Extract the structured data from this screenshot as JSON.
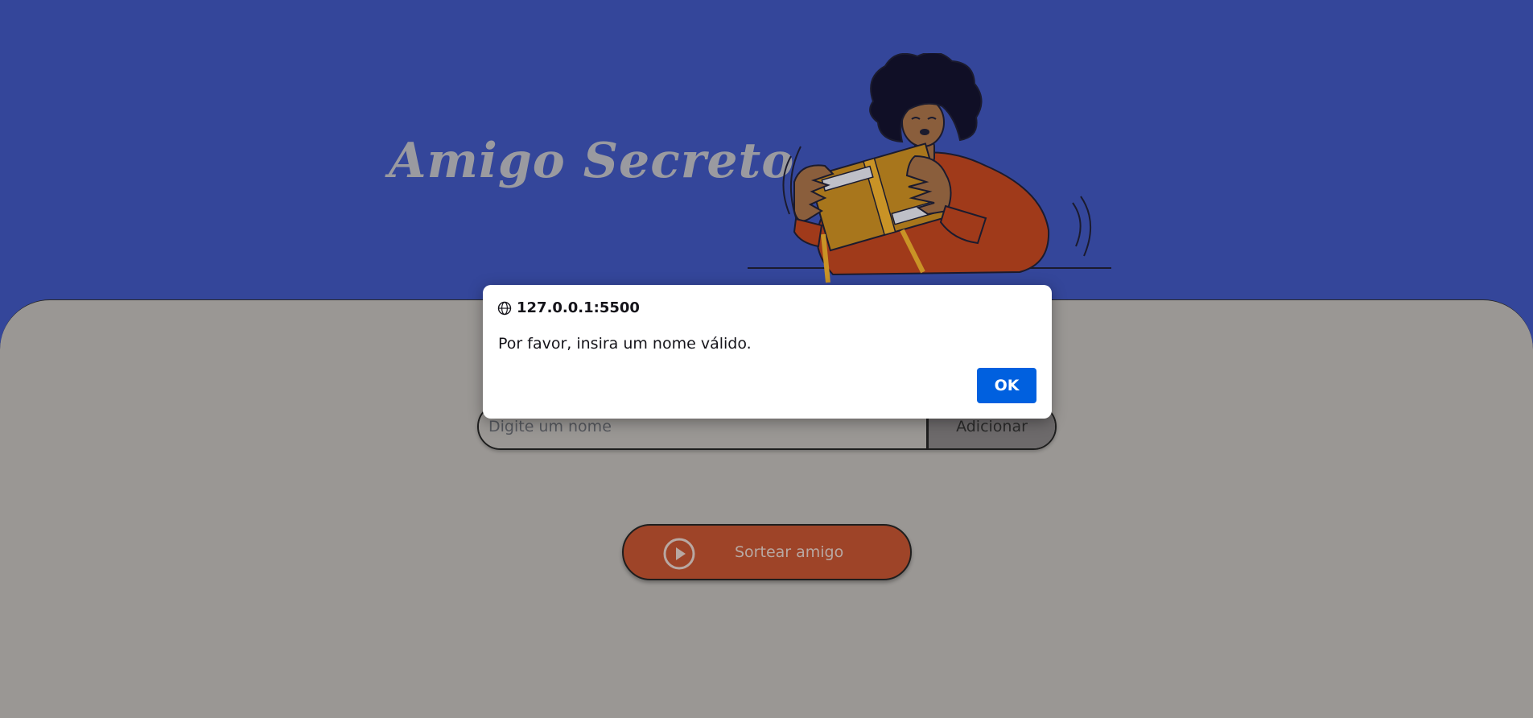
{
  "header": {
    "title": "Amigo Secreto"
  },
  "form": {
    "name_placeholder": "Digite um nome",
    "add_label": "Adicionar"
  },
  "draw": {
    "label": "Sortear amigo"
  },
  "dialog": {
    "origin": "127.0.0.1:5500",
    "message": "Por favor, insira um nome válido.",
    "ok_label": "OK"
  },
  "colors": {
    "header_bg": "#34469a",
    "panel_bg": "#9a9794",
    "draw_button": "#9e4428",
    "ok_button": "#0060df"
  }
}
